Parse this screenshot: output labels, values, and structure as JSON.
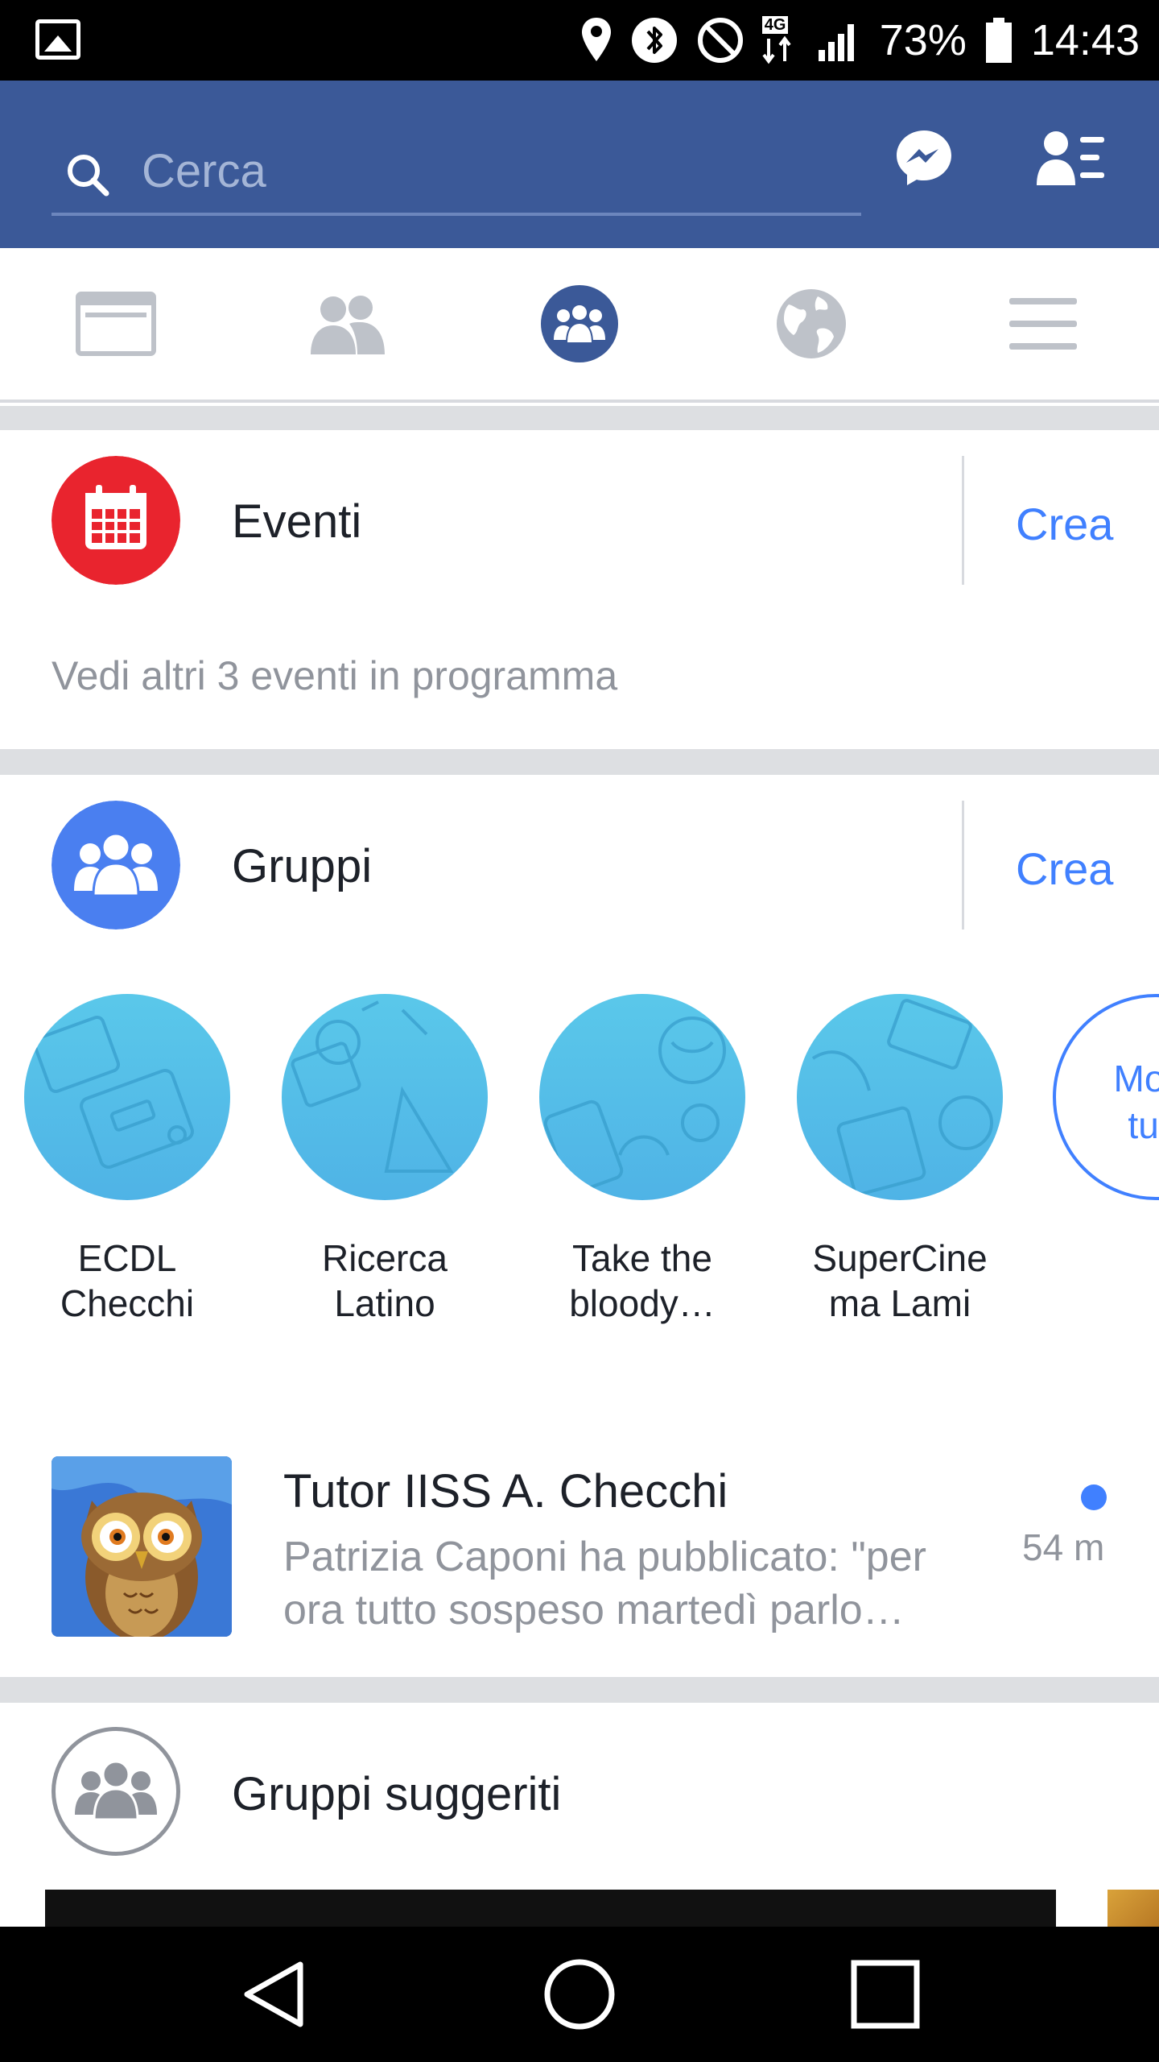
{
  "status_bar": {
    "network_type": "4G",
    "battery": "73%",
    "time": "14:43"
  },
  "header": {
    "search": {
      "placeholder": "Cerca",
      "value": ""
    },
    "icons": [
      "search-icon",
      "messenger-icon",
      "friend-requests-icon"
    ]
  },
  "tabs": [
    {
      "name": "news-feed",
      "icon": "news-feed-icon",
      "active": false
    },
    {
      "name": "friends",
      "icon": "friends-icon",
      "active": false
    },
    {
      "name": "groups",
      "icon": "groups-icon",
      "active": true
    },
    {
      "name": "notifications",
      "icon": "globe-icon",
      "active": false
    },
    {
      "name": "menu",
      "icon": "menu-icon",
      "active": false
    }
  ],
  "events": {
    "title": "Eventi",
    "create_label": "Crea",
    "more_text": "Vedi altri 3 eventi in programma",
    "icon": "calendar-icon"
  },
  "groups": {
    "title": "Gruppi",
    "create_label": "Crea",
    "icon": "groups-icon",
    "items": [
      {
        "line1": "ECDL",
        "line2": "Checchi"
      },
      {
        "line1": "Ricerca",
        "line2": "Latino"
      },
      {
        "line1": "Take the",
        "line2": "bloody…"
      },
      {
        "line1": "SuperCine",
        "line2": "ma Lami"
      }
    ],
    "see_all_line1": "Mos",
    "see_all_line2": "tut"
  },
  "feed": {
    "group_name": "Tutor IISS A. Checchi",
    "snippet": "Patrizia Caponi ha pubblicato: \"per ora tutto sospeso martedì parlo…",
    "time": "54 m"
  },
  "suggested": {
    "title": "Gruppi suggeriti",
    "icon": "groups-outline-icon"
  },
  "nav": {
    "icons": [
      "back-icon",
      "home-icon",
      "recents-icon"
    ]
  },
  "colors": {
    "header_blue": "#3b5998",
    "link_blue": "#4080ff",
    "event_red": "#e9242e",
    "group_blue": "#4a7ff0",
    "group_circle": "#53bde8"
  }
}
